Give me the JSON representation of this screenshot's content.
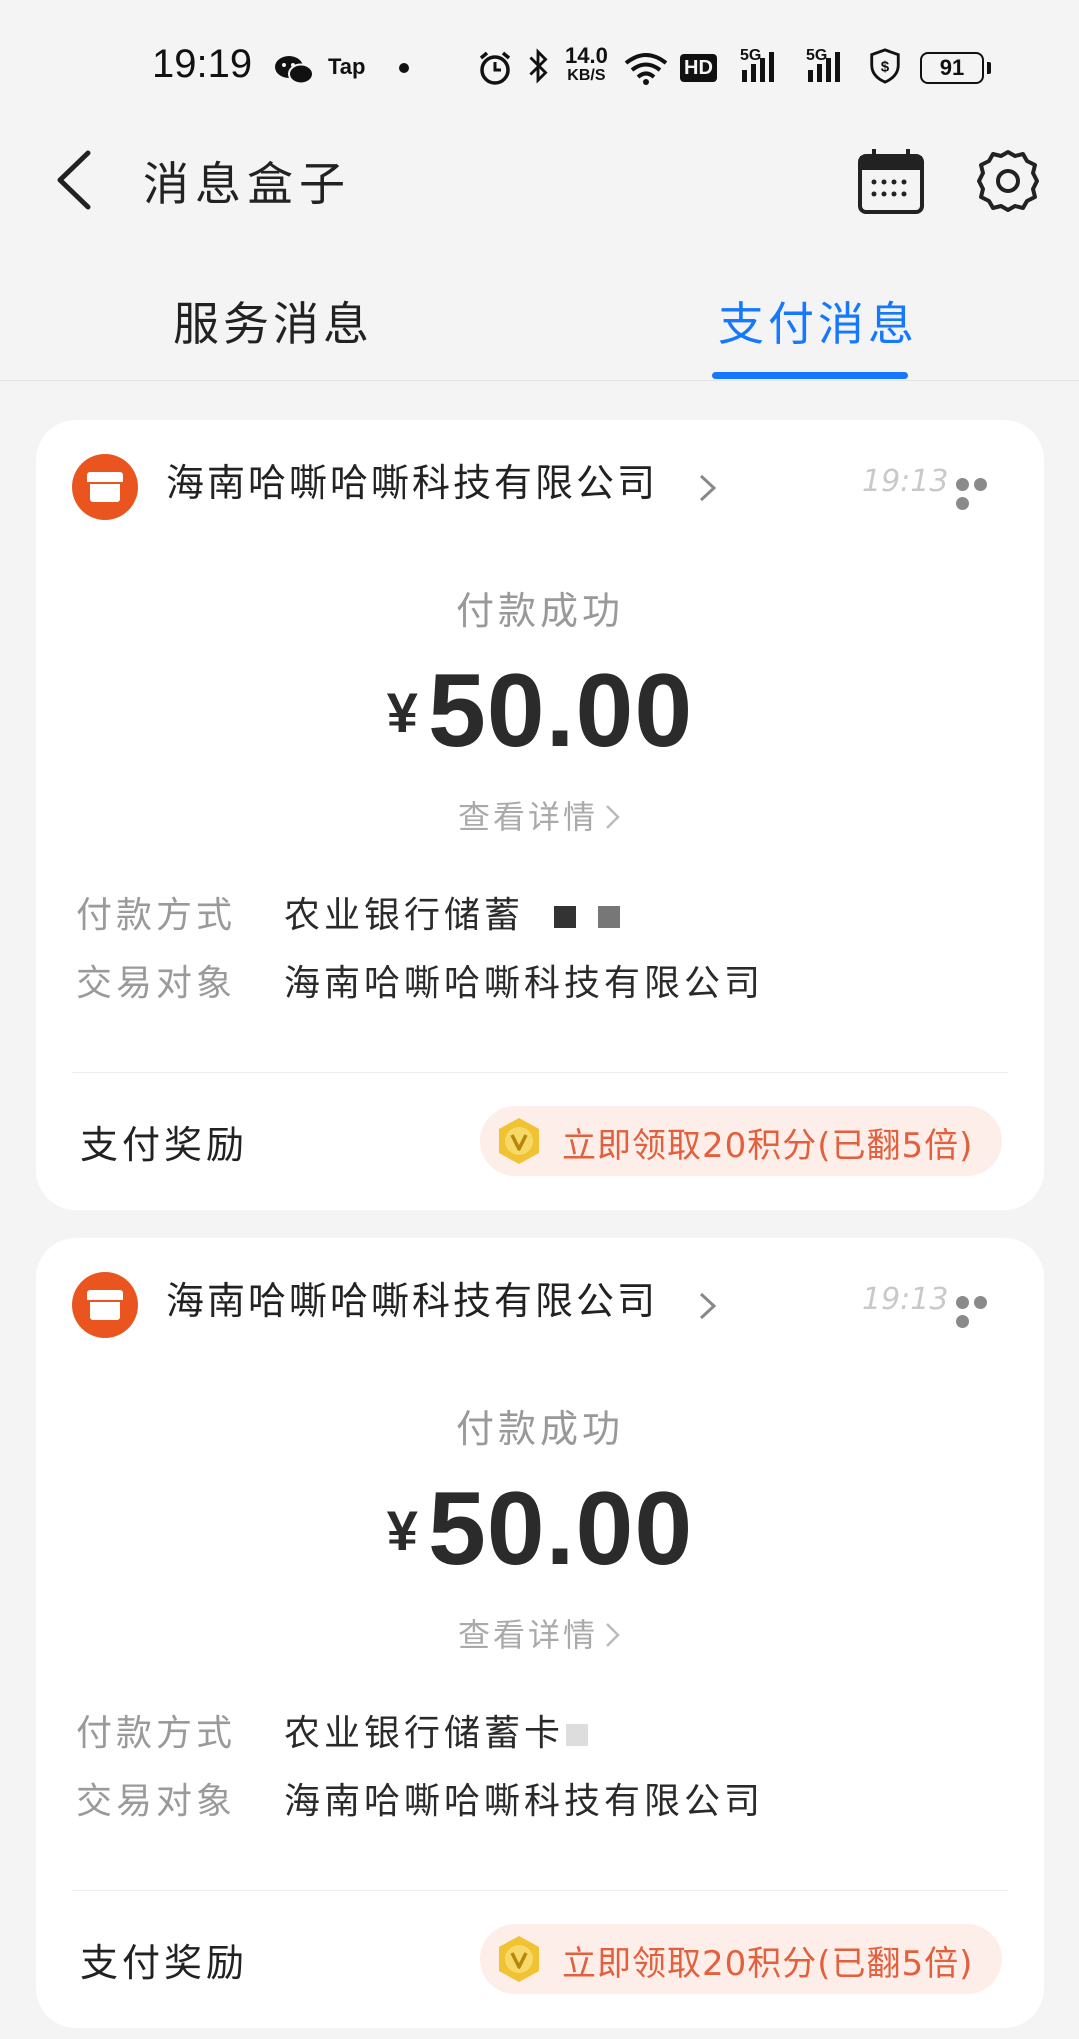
{
  "status_bar": {
    "time": "19:19",
    "tap_label": "Tap",
    "net_speed_value": "14.0",
    "net_speed_unit": "KB/S",
    "hd_label": "HD",
    "signal1_label": "5G",
    "signal2_label": "5G",
    "battery": "91"
  },
  "nav": {
    "title": "消息盒子"
  },
  "tabs": [
    {
      "label": "服务消息",
      "active": false
    },
    {
      "label": "支付消息",
      "active": true
    }
  ],
  "colors": {
    "accent": "#1677ff",
    "merchant_logo": "#e9541f",
    "reward_text": "#e45f3c",
    "reward_bg": "#fdeeea"
  },
  "messages": [
    {
      "merchant": "海南哈嘶哈嘶科技有限公司",
      "time": "19:13",
      "status": "付款成功",
      "currency": "¥",
      "amount": "50.00",
      "detail_link": "查看详情",
      "payment_method_label": "付款方式",
      "payment_method_value": "农业银行储蓄",
      "counterparty_label": "交易对象",
      "counterparty_value": "海南哈嘶哈嘶科技有限公司",
      "reward_label": "支付奖励",
      "reward_button": "立即领取20积分(已翻5倍)"
    },
    {
      "merchant": "海南哈嘶哈嘶科技有限公司",
      "time": "19:13",
      "status": "付款成功",
      "currency": "¥",
      "amount": "50.00",
      "detail_link": "查看详情",
      "payment_method_label": "付款方式",
      "payment_method_value": "农业银行储蓄卡",
      "counterparty_label": "交易对象",
      "counterparty_value": "海南哈嘶哈嘶科技有限公司",
      "reward_label": "支付奖励",
      "reward_button": "立即领取20积分(已翻5倍)"
    }
  ]
}
